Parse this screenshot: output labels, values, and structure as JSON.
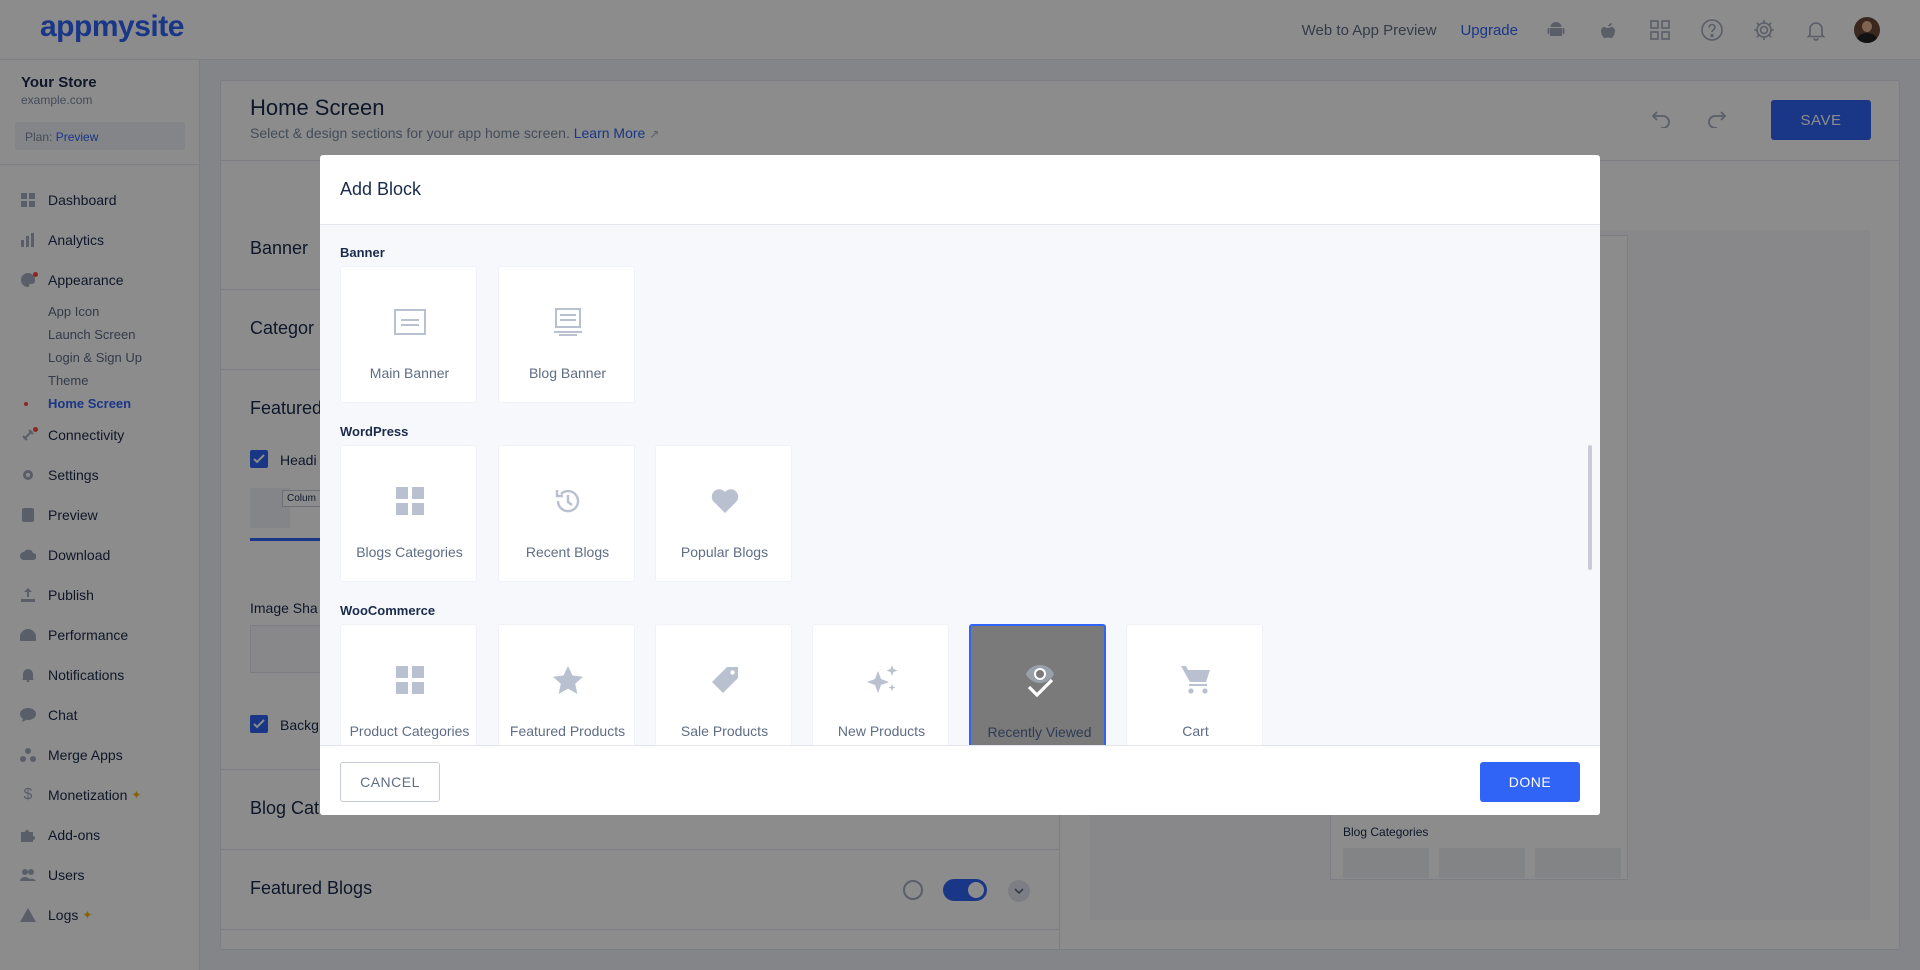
{
  "app": {
    "logo": "appmysite"
  },
  "topbar": {
    "web_preview": "Web to App Preview",
    "upgrade": "Upgrade",
    "icons": [
      "android-icon",
      "apple-icon",
      "apps-grid-icon",
      "help-icon",
      "settings-icon",
      "bell-icon",
      "user-avatar"
    ]
  },
  "sidebar": {
    "store_name": "Your Store",
    "store_url": "example.com",
    "plan_label": "Plan:",
    "plan_value": "Preview",
    "items": [
      {
        "label": "Dashboard",
        "icon": "dashboard-icon"
      },
      {
        "label": "Analytics",
        "icon": "analytics-icon"
      },
      {
        "label": "Appearance",
        "icon": "appearance-icon"
      },
      {
        "label": "Connectivity",
        "icon": "connectivity-icon"
      },
      {
        "label": "Settings",
        "icon": "settings-icon"
      },
      {
        "label": "Preview",
        "icon": "preview-icon"
      },
      {
        "label": "Download",
        "icon": "download-icon"
      },
      {
        "label": "Publish",
        "icon": "publish-icon"
      },
      {
        "label": "Performance",
        "icon": "performance-icon"
      },
      {
        "label": "Notifications",
        "icon": "notifications-icon"
      },
      {
        "label": "Chat",
        "icon": "chat-icon"
      },
      {
        "label": "Merge Apps",
        "icon": "merge-apps-icon"
      },
      {
        "label": "Monetization",
        "icon": "monetization-icon"
      },
      {
        "label": "Add-ons",
        "icon": "addons-icon"
      },
      {
        "label": "Users",
        "icon": "users-icon"
      },
      {
        "label": "Logs",
        "icon": "logs-icon"
      }
    ],
    "appearance_sub": [
      "App Icon",
      "Launch Screen",
      "Login & Sign Up",
      "Theme",
      "Home Screen"
    ]
  },
  "page": {
    "title": "Home Screen",
    "subtitle": "Select & design sections for your app home screen.",
    "learn_more": "Learn More",
    "save": "SAVE"
  },
  "sections": {
    "banner": "Banner",
    "categories": "Categor",
    "featured": "Featured",
    "heading_label": "Headi",
    "column_tooltip": "Colum",
    "image_shape": "Image Sha",
    "background_label": "Backg",
    "blog_categories": "Blog Cat",
    "featured_blogs": "Featured Blogs"
  },
  "preview": {
    "blog_categories": "Blog Categories"
  },
  "modal": {
    "title": "Add Block",
    "groups": [
      {
        "label": "Banner",
        "blocks": [
          {
            "label": "Main Banner",
            "icon": "banner-icon"
          },
          {
            "label": "Blog Banner",
            "icon": "blog-banner-icon"
          }
        ]
      },
      {
        "label": "WordPress",
        "blocks": [
          {
            "label": "Blogs Categories",
            "icon": "grid-icon"
          },
          {
            "label": "Recent Blogs",
            "icon": "history-icon"
          },
          {
            "label": "Popular Blogs",
            "icon": "heart-icon"
          }
        ]
      },
      {
        "label": "WooCommerce",
        "blocks": [
          {
            "label": "Product Categories",
            "icon": "grid-icon"
          },
          {
            "label": "Featured Products",
            "icon": "star-icon"
          },
          {
            "label": "Sale Products",
            "icon": "tag-icon"
          },
          {
            "label": "New Products",
            "icon": "sparkle-icon"
          },
          {
            "label": "Recently Viewed Products",
            "icon": "eye-check-icon",
            "selected": true
          },
          {
            "label": "Cart",
            "icon": "cart-icon"
          }
        ]
      }
    ],
    "cancel": "CANCEL",
    "done": "DONE"
  },
  "colors": {
    "accent": "#3064f6",
    "text": "#1a2b4b",
    "muted": "#7d8ba3",
    "alert": "#ff4848"
  }
}
